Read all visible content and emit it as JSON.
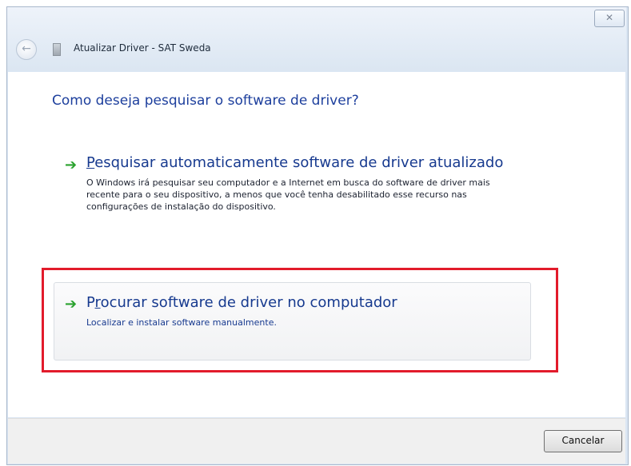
{
  "window": {
    "title": "Atualizar Driver - SAT Sweda",
    "close_glyph": "✕",
    "back_glyph": "←"
  },
  "main": {
    "heading": "Como deseja pesquisar o software de driver?",
    "options": [
      {
        "accel": "P",
        "title_rest": "esquisar automaticamente software de driver atualizado",
        "description": "O Windows irá pesquisar seu computador e a Internet em busca do software de driver mais recente para o seu dispositivo, a menos que você tenha desabilitado esse recurso nas configurações de instalação do dispositivo."
      },
      {
        "accel_pre": "P",
        "accel": "r",
        "title_rest": "ocurar software de driver no computador",
        "description": "Localizar e instalar software manualmente."
      }
    ]
  },
  "footer": {
    "cancel_label": "Cancelar"
  },
  "colors": {
    "highlight": "#e21b2b",
    "arrow": "#2aa22e",
    "link": "#173a8f"
  }
}
